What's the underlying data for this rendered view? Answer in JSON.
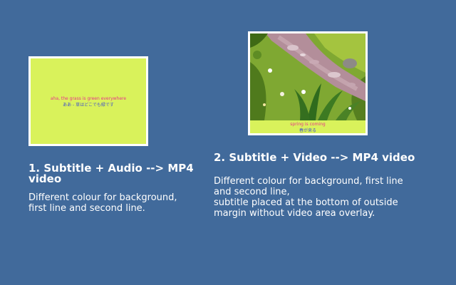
{
  "slide": {
    "background_color": "#416a9b",
    "cards": [
      {
        "title": "1. Subtitle + Audio --> MP4 video",
        "description": "Different colour for background,\nfirst line and second line.",
        "thumbnail": {
          "background_color": "#d9f25b",
          "subtitle_line1": "aha, the grass is green everywhere",
          "subtitle_line2": "ああ - 草はどこでも緑です",
          "line1_color": "#e8338a",
          "line2_color": "#4455c9"
        }
      },
      {
        "title": "2. Subtitle + Video --> MP4 video",
        "description": "Different colour for background, first line\nand second line,\nsubtitle placed at the bottom of outside\nmargin without video area overlay.",
        "thumbnail": {
          "background_color": "#d9f25b",
          "subtitle_line1": "spring is coming",
          "subtitle_line2": "春が来る",
          "line1_color": "#e8338a",
          "line2_color": "#4455c9",
          "video_scene": "grass-and-stream-frame"
        }
      }
    ]
  }
}
